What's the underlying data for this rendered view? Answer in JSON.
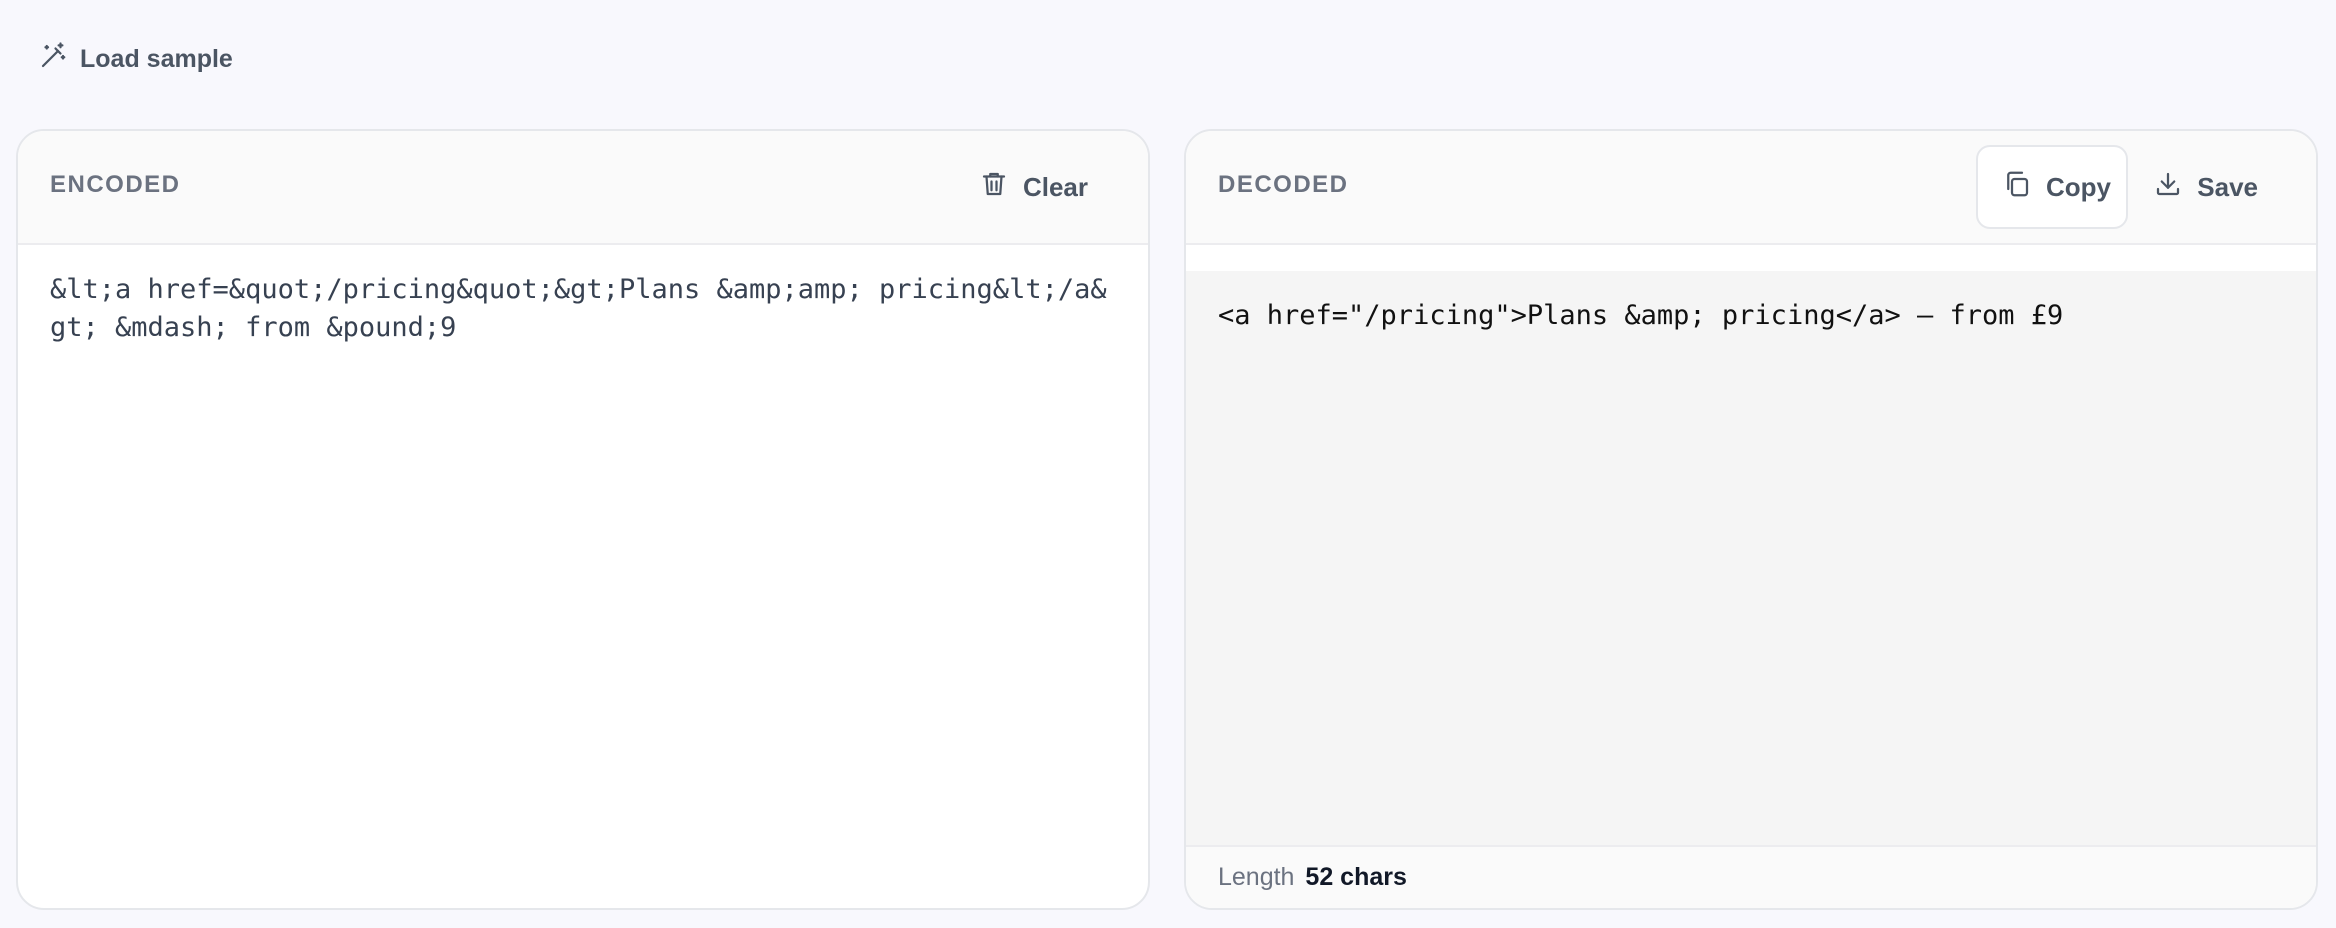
{
  "toolbar": {
    "load_sample_label": "Load sample"
  },
  "encoded": {
    "title": "ENCODED",
    "clear_label": "Clear",
    "value": "&lt;a href=&quot;/pricing&quot;&gt;Plans &amp;amp; pricing&lt;/a&gt; &mdash; from &pound;9"
  },
  "decoded": {
    "title": "DECODED",
    "copy_label": "Copy",
    "save_label": "Save",
    "value": "<a href=\"/pricing\">Plans &amp; pricing</a> — from £9",
    "length_label": "Length",
    "length_value": "52 chars"
  },
  "icons": {
    "load_sample": "magic-wand-icon",
    "clear": "trash-icon",
    "copy": "copy-icon",
    "save": "download-icon"
  }
}
